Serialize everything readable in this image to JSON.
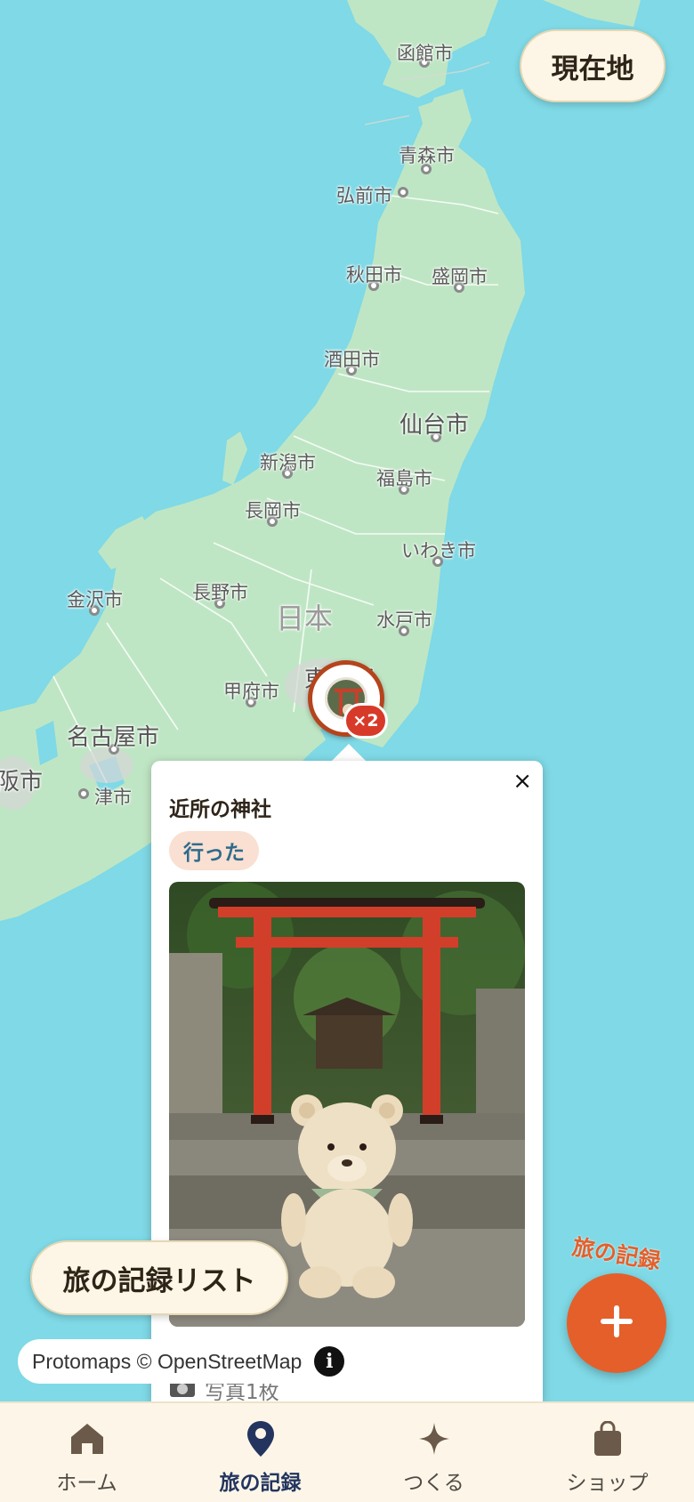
{
  "map": {
    "cities": [
      {
        "name": "函館市",
        "size": "normal"
      },
      {
        "name": "青森市",
        "size": "normal"
      },
      {
        "name": "弘前市",
        "size": "normal"
      },
      {
        "name": "秋田市",
        "size": "normal"
      },
      {
        "name": "盛岡市",
        "size": "normal"
      },
      {
        "name": "酒田市",
        "size": "normal"
      },
      {
        "name": "仙台市",
        "size": "big"
      },
      {
        "name": "新潟市",
        "size": "normal"
      },
      {
        "name": "福島市",
        "size": "normal"
      },
      {
        "name": "長岡市",
        "size": "normal"
      },
      {
        "name": "いわき市",
        "size": "normal"
      },
      {
        "name": "金沢市",
        "size": "normal"
      },
      {
        "name": "長野市",
        "size": "normal"
      },
      {
        "name": "日本",
        "size": "country"
      },
      {
        "name": "水戸市",
        "size": "normal"
      },
      {
        "name": "甲府市",
        "size": "normal"
      },
      {
        "name": "東京都",
        "size": "big"
      },
      {
        "name": "名古屋市",
        "size": "big"
      },
      {
        "name": "大阪市",
        "size": "big"
      },
      {
        "name": "津市",
        "size": "normal"
      }
    ],
    "marker_badge": "×2"
  },
  "header": {
    "locate_label": "現在地"
  },
  "popup": {
    "close_label": "×",
    "title": "近所の神社",
    "status": "行った",
    "photo_count": "写真1枚"
  },
  "list_button_label": "旅の記録リスト",
  "attribution": {
    "text": "Protomaps © OpenStreetMap",
    "info_label": "i"
  },
  "fab": {
    "label": "旅の記録"
  },
  "tabs": [
    {
      "label": "ホーム",
      "icon": "home-icon",
      "active": false
    },
    {
      "label": "旅の記録",
      "icon": "map-pin-icon",
      "active": true
    },
    {
      "label": "つくる",
      "icon": "sparkle-icon",
      "active": false
    },
    {
      "label": "ショップ",
      "icon": "shopping-bag-icon",
      "active": false
    }
  ],
  "colors": {
    "accent": "#e55f2a",
    "active_tab": "#23355f",
    "sea": "#7fd9e6",
    "land": "#bfe6c4"
  }
}
